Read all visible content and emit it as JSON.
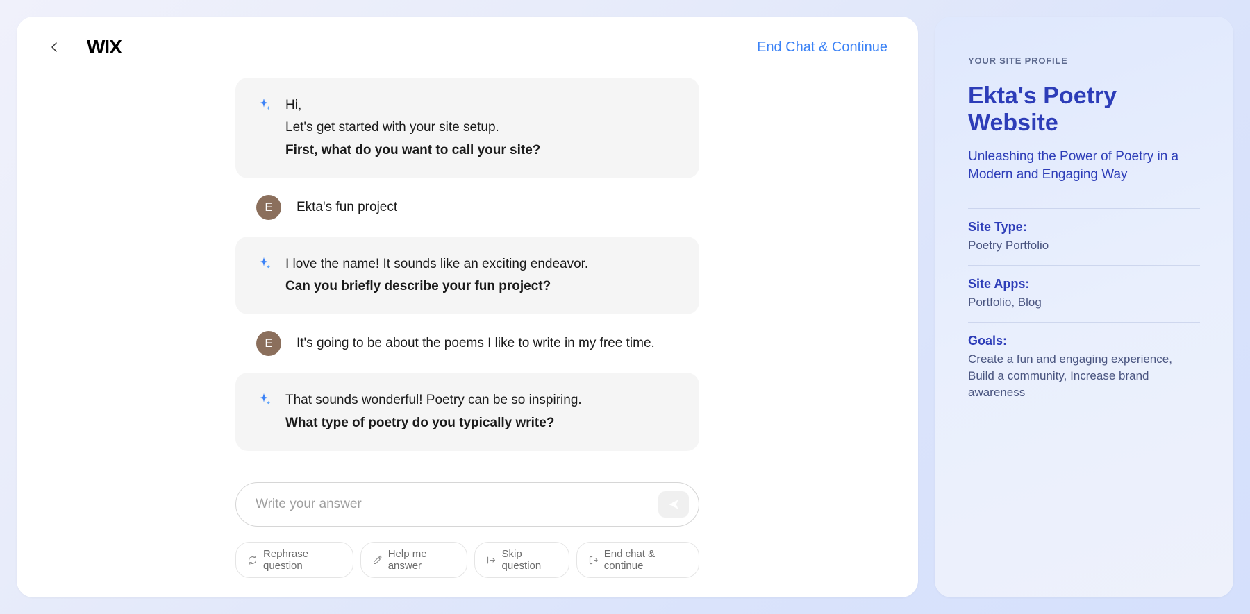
{
  "header": {
    "logo": "WIX",
    "end_chat": "End Chat & Continue"
  },
  "chat": {
    "messages": [
      {
        "role": "ai",
        "lines": [
          "Hi,",
          "Let's get started with your site setup."
        ],
        "bold": "First, what do you want to call your site?"
      },
      {
        "role": "user",
        "initial": "E",
        "text": "Ekta's fun project"
      },
      {
        "role": "ai",
        "lines": [
          "I love the name! It sounds like an exciting endeavor."
        ],
        "bold": "Can you briefly describe your fun project?"
      },
      {
        "role": "user",
        "initial": "E",
        "text": "It's going to be about the poems I like to write in my free time."
      },
      {
        "role": "ai",
        "lines": [
          "That sounds wonderful! Poetry can be so inspiring."
        ],
        "bold": "What type of poetry do you typically write?"
      }
    ]
  },
  "input": {
    "placeholder": "Write your answer"
  },
  "chips": [
    {
      "icon": "refresh",
      "label": "Rephrase question"
    },
    {
      "icon": "pencil-sparkle",
      "label": "Help me answer"
    },
    {
      "icon": "skip",
      "label": "Skip question"
    },
    {
      "icon": "exit",
      "label": "End chat & continue"
    }
  ],
  "profile": {
    "label": "YOUR SITE PROFILE",
    "title": "Ekta's Poetry Website",
    "subtitle": "Unleashing the Power of Poetry in a Modern and Engaging Way",
    "rows": [
      {
        "key": "Site Type:",
        "val": "Poetry Portfolio"
      },
      {
        "key": "Site Apps:",
        "val": "Portfolio, Blog"
      },
      {
        "key": "Goals:",
        "val": "Create a fun and engaging experience, Build a community, Increase brand awareness"
      }
    ]
  }
}
